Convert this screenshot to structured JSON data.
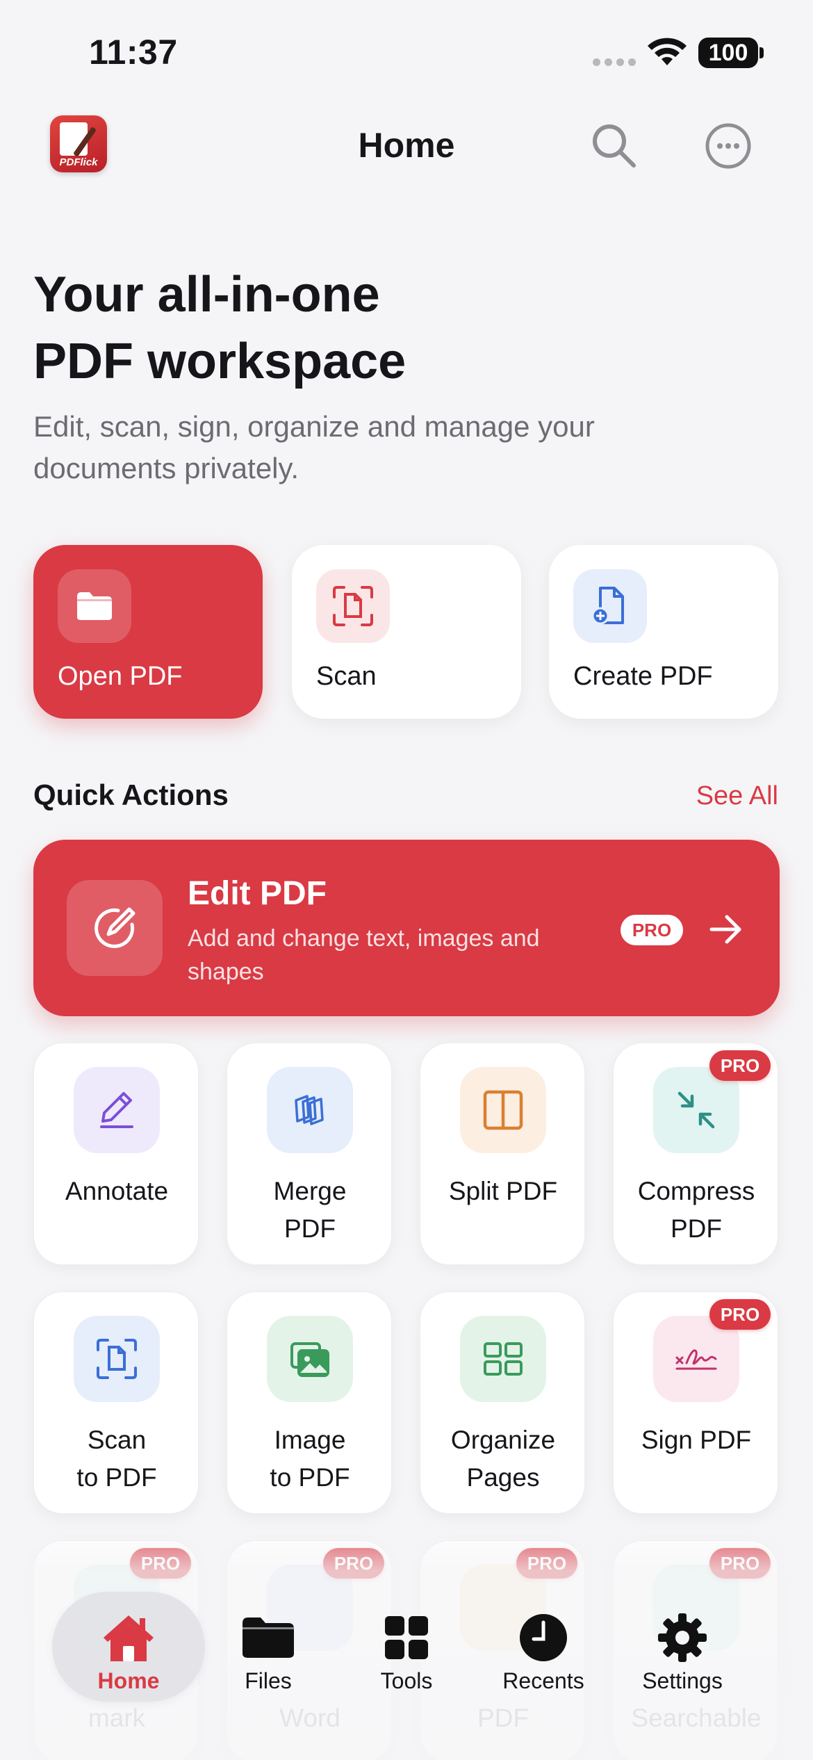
{
  "status": {
    "time": "11:37",
    "battery": "100"
  },
  "nav": {
    "title": "Home",
    "logo_text": "PDFlick"
  },
  "hero": {
    "title_line1": "Your all-in-one",
    "title_line2": "PDF workspace",
    "subtitle": "Edit, scan, sign, organize and manage your documents privately."
  },
  "primary_actions": [
    {
      "label": "Open PDF",
      "icon": "folder-icon"
    },
    {
      "label": "Scan",
      "icon": "scan-icon"
    },
    {
      "label": "Create PDF",
      "icon": "create-file-icon"
    }
  ],
  "quick_actions": {
    "title": "Quick Actions",
    "see_all": "See All",
    "featured": {
      "title": "Edit PDF",
      "subtitle": "Add and change text, images and shapes",
      "badge": "PRO",
      "icon": "edit-icon"
    }
  },
  "tools": [
    {
      "label": "Annotate",
      "icon": "pencil-icon"
    },
    {
      "label": "Merge\nPDF",
      "icon": "merge-icon"
    },
    {
      "label": "Split PDF",
      "icon": "split-icon"
    },
    {
      "label": "Compress\nPDF",
      "icon": "compress-icon",
      "badge": "PRO"
    },
    {
      "label": "Scan\nto PDF",
      "icon": "scan-doc-icon"
    },
    {
      "label": "Image\nto PDF",
      "icon": "image-icon"
    },
    {
      "label": "Organize\nPages",
      "icon": "grid-icon"
    },
    {
      "label": "Sign PDF",
      "icon": "signature-icon",
      "badge": "PRO"
    },
    {
      "label": "mark",
      "badge": "PRO"
    },
    {
      "label": "Word",
      "badge": "PRO"
    },
    {
      "label": "PDF",
      "badge": "PRO"
    },
    {
      "label": "Searchable",
      "badge": "PRO"
    }
  ],
  "tabs": [
    {
      "label": "Home",
      "icon": "home-icon",
      "active": true
    },
    {
      "label": "Files",
      "icon": "folder-icon"
    },
    {
      "label": "Tools",
      "icon": "grid-icon"
    },
    {
      "label": "Recents",
      "icon": "clock-icon"
    },
    {
      "label": "Settings",
      "icon": "gear-icon"
    }
  ],
  "colors": {
    "accent": "#d93a44",
    "background": "#f5f5f7"
  }
}
